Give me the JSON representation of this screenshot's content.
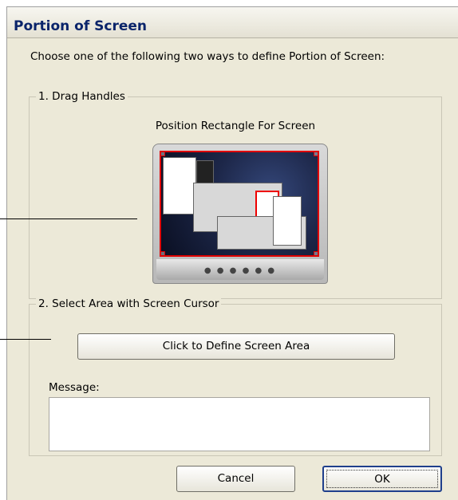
{
  "dialog": {
    "title": "Portion of Screen",
    "intro": "Choose one of the following two ways to define Portion of Screen:"
  },
  "drag_handles": {
    "label": "1. Drag Handles",
    "caption": "Position Rectangle For Screen",
    "image_description": "monitor-with-red-selection-rectangle"
  },
  "select_area": {
    "label": "2. Select Area with Screen Cursor",
    "define_button": "Click to Define Screen Area",
    "message_label": "Message:",
    "message_value": ""
  },
  "buttons": {
    "cancel": "Cancel",
    "ok": "OK"
  },
  "colors": {
    "selection": "#e00000",
    "title": "#0a246a"
  }
}
